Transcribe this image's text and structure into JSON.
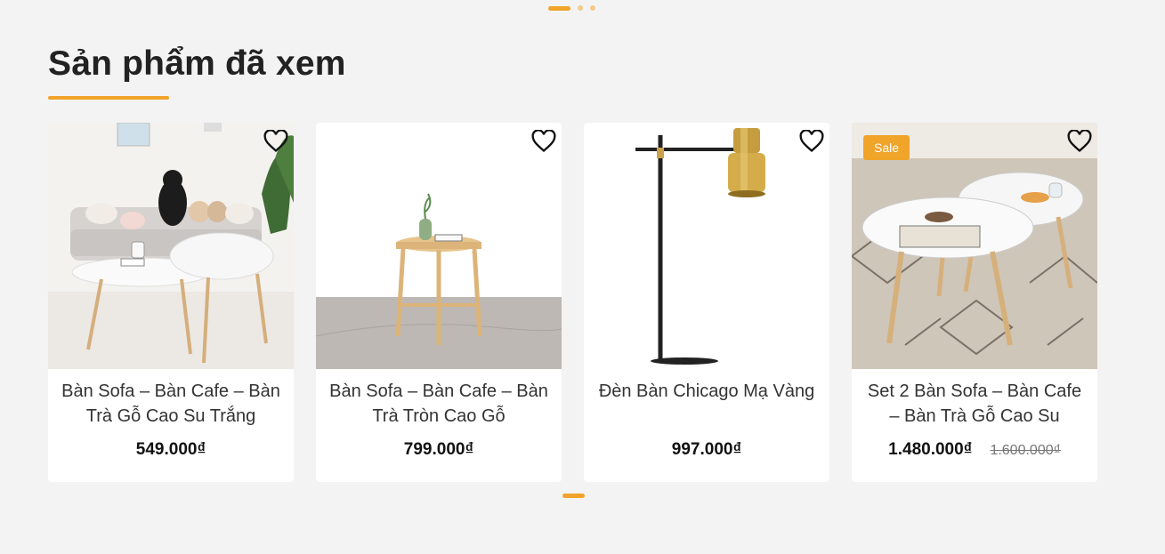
{
  "section": {
    "title": "Sản phẩm đã xem"
  },
  "top_pagination": {
    "count": 3,
    "active": 0
  },
  "products": [
    {
      "name": "Bàn Sofa – Bàn Cafe – Bàn Trà Gỗ Cao Su Trắng",
      "price": "549.000₫",
      "old_price": "",
      "badge": ""
    },
    {
      "name": "Bàn Sofa – Bàn Cafe – Bàn Trà Tròn Cao Gỗ",
      "price": "799.000₫",
      "old_price": "",
      "badge": ""
    },
    {
      "name": "Đèn Bàn Chicago Mạ Vàng",
      "price": "997.000₫",
      "old_price": "",
      "badge": ""
    },
    {
      "name": "Set 2 Bàn Sofa – Bàn Cafe – Bàn Trà Gỗ Cao Su",
      "price": "1.480.000₫",
      "old_price": "1.600.000₫",
      "badge": "Sale"
    }
  ],
  "bottom_pagination": {
    "count": 1,
    "active": 0
  },
  "colors": {
    "accent": "#f0a42a",
    "background": "#f3f3f3",
    "card": "#ffffff"
  }
}
